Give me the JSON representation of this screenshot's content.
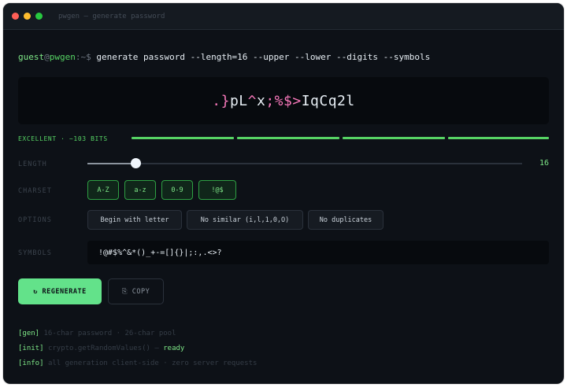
{
  "window": {
    "title": "pwgen — generate password",
    "dots": {
      "close": "#ff5f57",
      "minimize": "#febc2e",
      "maximize": "#28c840"
    }
  },
  "prompt": {
    "user": "guest",
    "at": "@",
    "host": "pwgen",
    "path": ":~$",
    "command": "generate password --length=16 --upper --lower --digits --symbols"
  },
  "password": {
    "part1": ".}",
    "part2": "pL",
    "part3": "^",
    "part4": "x",
    "part5": ";%$>",
    "part6": "IqCq2l"
  },
  "strength": {
    "label": "EXCELLENT · ~103 BITS",
    "segments_filled": 4,
    "segments_total": 4,
    "color": "#56d364"
  },
  "length": {
    "label": "LENGTH",
    "value": "16",
    "fraction": 0.11
  },
  "charset": {
    "label": "CHARSET",
    "options": [
      {
        "label": "A-Z",
        "active": true
      },
      {
        "label": "a-z",
        "active": true
      },
      {
        "label": "0-9",
        "active": true
      },
      {
        "label": "!@$",
        "active": true
      }
    ]
  },
  "options": {
    "label": "OPTIONS",
    "items": [
      {
        "label": "Begin with letter"
      },
      {
        "label": "No similar (i,l,1,0,O)"
      },
      {
        "label": "No duplicates"
      }
    ]
  },
  "symbols": {
    "label": "SYMBOLS",
    "value": "!@#$%^&*()_+-=[]{}|;:,.<>?"
  },
  "actions": {
    "regenerate": "↻ REGENERATE",
    "copy": "⎘ COPY"
  },
  "log": [
    {
      "tag": "[gen]",
      "text": "16-char password · 26-char pool",
      "status": ""
    },
    {
      "tag": "[init]",
      "text": "crypto.getRandomValues() —",
      "status": "ready"
    },
    {
      "tag": "[info]",
      "text": "all generation client-side · zero server requests",
      "status": ""
    }
  ],
  "colors": {
    "accent": "#63e28a",
    "background": "#0d1117",
    "symbol_pink": "#f778ba"
  }
}
